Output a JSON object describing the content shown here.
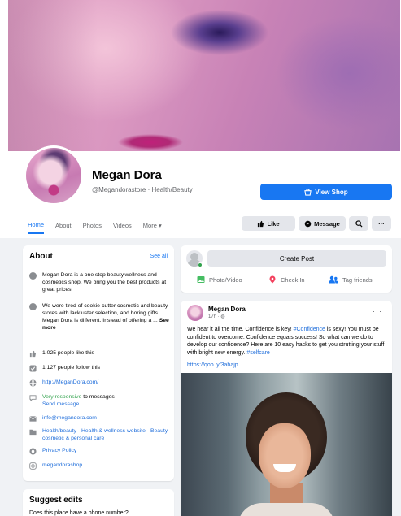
{
  "profile": {
    "name": "Megan Dora",
    "handle": "@Megandorastore · Health/Beauty",
    "view_shop": "View Shop"
  },
  "tabs": [
    {
      "label": "Home",
      "active": true
    },
    {
      "label": "About"
    },
    {
      "label": "Photos"
    },
    {
      "label": "Videos"
    },
    {
      "label": "More ▾"
    }
  ],
  "actions": {
    "like": "Like",
    "message": "Message",
    "more": "···"
  },
  "about": {
    "title": "About",
    "see_all": "See all",
    "desc1": "Megan Dora is a one stop beauty,wellness and cosmetics shop. We bring you the best products at great prices.",
    "desc2": "We were tired of cookie-cutter cosmetic and beauty stores with lackluster selection, and boring gifts. Megan Dora is different. Instead of offering a ...",
    "see_more": "See more",
    "likes": "1,025 people like this",
    "follows": "1,127 people follow this",
    "website": "http://MeganDora.com/",
    "responsive_green": "Very responsive",
    "responsive_rest": " to messages",
    "send_message": "Send message",
    "email": "info@megandora.com",
    "category": "Health/beauty · Health & wellness website · Beauty, cosmetic & personal care",
    "privacy": "Privacy Policy",
    "instagram": "megandorashop"
  },
  "suggest": {
    "title": "Suggest edits",
    "question": "Does this place have a phone number?"
  },
  "create_post": {
    "button": "Create Post",
    "photo_video": "Photo/Video",
    "check_in": "Check In",
    "tag_friends": "Tag friends"
  },
  "post": {
    "author": "Megan Dora",
    "time": "17h · ◍",
    "text_a": "We hear it all the time. Confidence is key! ",
    "tag1": "#Confidence",
    "text_b": " is sexy! You must be confident to overcome. Confidence equals success! So what can we do to develop our confidence? Here are 10 easy hacks to get you strutting your stuff with bright new energy. ",
    "tag2": "#selfcare",
    "link": "https://qoo.ly/3abajp",
    "more": "···"
  },
  "colors": {
    "accent": "#1877f2",
    "background": "#f0f2f5",
    "link": "#216fdb",
    "online": "#31a24c",
    "icon_gray": "#8a8d91"
  }
}
